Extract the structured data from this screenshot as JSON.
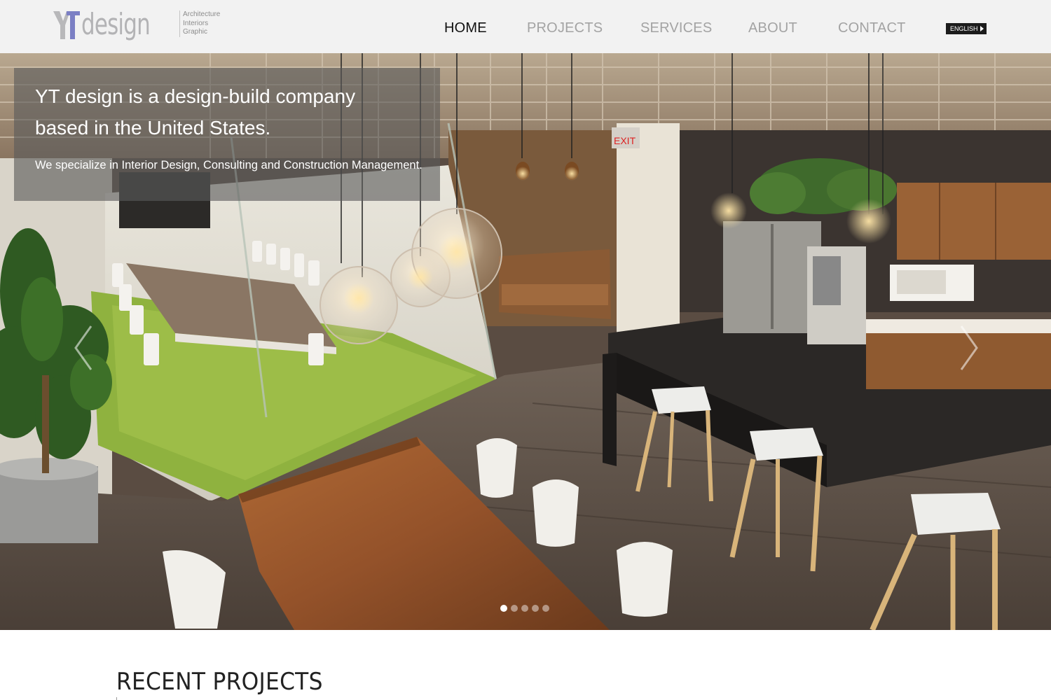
{
  "header": {
    "logo": {
      "mark": "YT",
      "word": "design",
      "tagline": [
        "Architecture",
        "Interiors",
        "Graphic"
      ]
    },
    "nav": [
      {
        "label": "HOME",
        "active": true
      },
      {
        "label": "PROJECTS",
        "active": false
      },
      {
        "label": "SERVICES",
        "active": false
      },
      {
        "label": "ABOUT",
        "active": false
      },
      {
        "label": "CONTACT",
        "active": false
      }
    ],
    "language": "ENGLISH"
  },
  "hero": {
    "headline_line1": "YT design is a design-build company",
    "headline_line2": "based in the United States.",
    "subline": "We specialize in Interior Design, Consulting and Construction Management.",
    "slide_count": 5,
    "active_slide": 1,
    "exit_sign": "EXIT"
  },
  "section": {
    "title": "RECENT PROJECTS"
  },
  "colors": {
    "header_bg": "#f2f2f2",
    "nav_active": "#111111",
    "nav_inactive": "#a3a3a3",
    "logo_accent": "#7b7fc4",
    "caption_bg": "rgba(90,90,90,0.62)"
  }
}
